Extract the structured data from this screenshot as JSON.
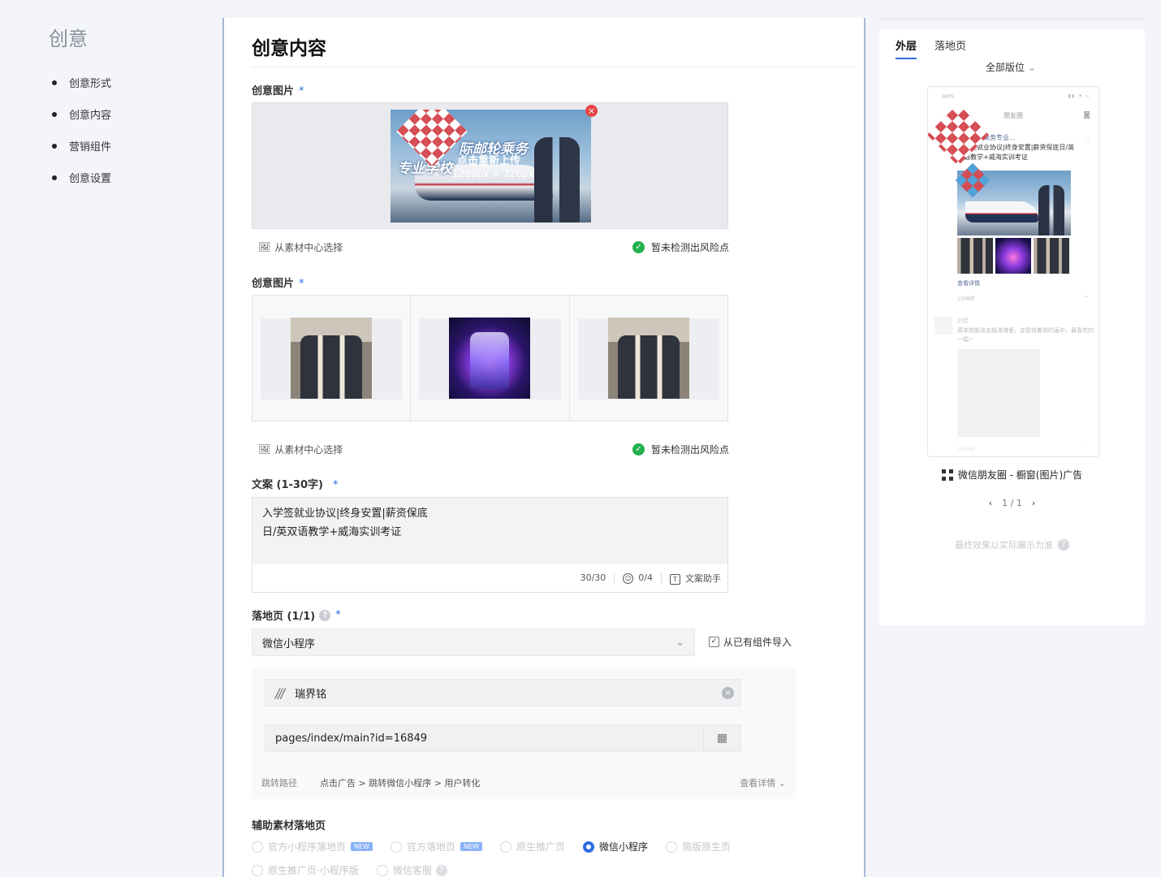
{
  "left_nav": {
    "title": "创意",
    "items": [
      "创意形式",
      "创意内容",
      "营销组件",
      "创意设置"
    ]
  },
  "main": {
    "heading": "创意内容",
    "image_section_1": {
      "label": "创意图片",
      "required_mark": "*",
      "banner": {
        "title_line_1": "际邮轮乘务",
        "title_line_2": "专业学校",
        "upload_text": "点击重新上传",
        "size_text": "1280px × 720px"
      },
      "remove_icon": "close-icon",
      "choose_label": "从素材中心选择",
      "risk_status": "暂未检测出风险点"
    },
    "image_section_2": {
      "label": "创意图片",
      "required_mark": "*",
      "thumbnails": [
        "staff-photo",
        "cruise-ship-photo",
        "staff-photo"
      ],
      "choose_label": "从素材中心选择",
      "risk_status": "暂未检测出风险点"
    },
    "copy": {
      "label": "文案 (1-30字)",
      "required_mark": "*",
      "line_1": "入学签就业协议|终身安置|薪资保底",
      "line_2": "日/英双语教学+威海实训考证",
      "count": "30/30",
      "emoji_count": "0/4",
      "assistant_label": "文案助手"
    },
    "landing": {
      "label": "落地页 (1/1)",
      "required_mark": "*",
      "select_value": "微信小程序",
      "import_label": "从已有组件导入",
      "app_name": "瑞界铭",
      "app_logo": "///",
      "page_path": "pages/index/main?id=16849",
      "jump_label": "跳转路径",
      "jump_value": "点击广告 > 跳转微信小程序 > 用户转化",
      "detail_label": "查看详情"
    },
    "aux": {
      "label": "辅助素材落地页",
      "options": [
        {
          "label": "官方小程序落地页",
          "badge": "NEW",
          "selected": false
        },
        {
          "label": "官方落地页",
          "badge": "NEW",
          "selected": false
        },
        {
          "label": "原生推广页",
          "badge": "",
          "selected": false
        },
        {
          "label": "微信小程序",
          "badge": "",
          "selected": true
        },
        {
          "label": "简版原生页",
          "badge": "",
          "selected": false
        }
      ],
      "options_row2": [
        {
          "label": "原生推广页·小程序版",
          "selected": false
        },
        {
          "label": "微信客服",
          "selected": false
        }
      ]
    }
  },
  "preview": {
    "tabs": [
      "外层",
      "落地页"
    ],
    "active_tab": 0,
    "position_select": "全部版位",
    "phone": {
      "status_left": "AMS",
      "nav_title": "朋友圈",
      "ad_name": "国际邮轮乘务专业...",
      "ad_text": "入学签就业协议|终身安置|薪资保底日/英双语教学+威海实训考证",
      "detail_link": "查看详情",
      "time": "1分钟前",
      "more": "··",
      "friend_name": "刘佳",
      "friend_text": "周末就能该去趟海滩里，这是找着到的画中、最喜欢的一幅~",
      "friend_time": "1分钟前"
    },
    "ad_type": "微信朋友圈 - 橱窗(图片)广告",
    "pager": "1 / 1",
    "note": "最终效果以实际展示为准"
  }
}
